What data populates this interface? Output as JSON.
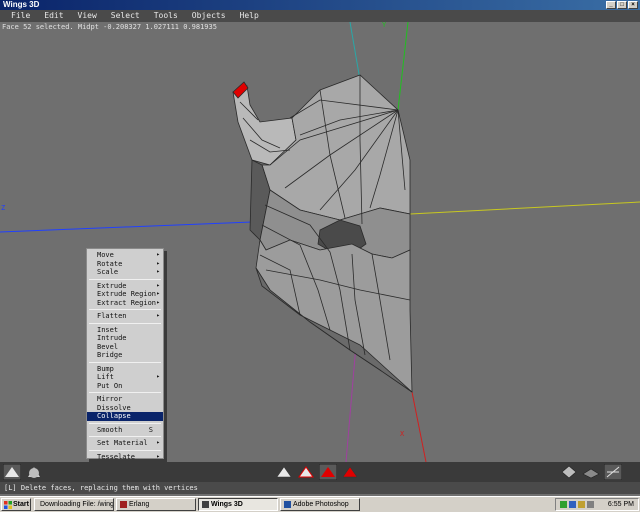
{
  "window": {
    "title": "Wings 3D"
  },
  "menubar": {
    "items": [
      "File",
      "Edit",
      "View",
      "Select",
      "Tools",
      "Objects",
      "Help"
    ]
  },
  "viewport": {
    "info": "Face 52 selected. Midpt -0.208327 1.027111 0.981935",
    "axis_labels": {
      "y": "Y",
      "z": "Z",
      "x": "X"
    }
  },
  "context_menu": {
    "groups": [
      [
        {
          "label": "Move",
          "submenu": true
        },
        {
          "label": "Rotate",
          "submenu": true
        },
        {
          "label": "Scale",
          "submenu": true
        }
      ],
      [
        {
          "label": "Extrude",
          "submenu": true
        },
        {
          "label": "Extrude Region",
          "submenu": true
        },
        {
          "label": "Extract Region",
          "submenu": true
        }
      ],
      [
        {
          "label": "Flatten",
          "submenu": true
        }
      ],
      [
        {
          "label": "Inset"
        },
        {
          "label": "Intrude"
        },
        {
          "label": "Bevel"
        },
        {
          "label": "Bridge"
        }
      ],
      [
        {
          "label": "Bump"
        },
        {
          "label": "Lift",
          "submenu": true
        },
        {
          "label": "Put On"
        }
      ],
      [
        {
          "label": "Mirror"
        },
        {
          "label": "Dissolve"
        },
        {
          "label": "Collapse",
          "active": true
        }
      ],
      [
        {
          "label": "Smooth",
          "hotkey": "S"
        }
      ],
      [
        {
          "label": "Set Material",
          "submenu": true
        }
      ],
      [
        {
          "label": "Tesselate",
          "submenu": true
        }
      ]
    ]
  },
  "status": {
    "text": "[L] Delete faces, replacing them with vertices"
  },
  "taskbar": {
    "start": "Start",
    "tasks": [
      {
        "label": "Downloading File: /wings/...",
        "pressed": false
      },
      {
        "label": "Erlang",
        "pressed": false
      },
      {
        "label": "Wings 3D",
        "pressed": true
      },
      {
        "label": "Adobe Photoshop",
        "pressed": false
      }
    ],
    "clock": "6:55 PM"
  },
  "colors": {
    "selection": "#e00000",
    "menu_highlight": "#0a246a",
    "axis_x": "#d02020",
    "axis_y": "#20c020",
    "axis_z": "#2040ff"
  }
}
